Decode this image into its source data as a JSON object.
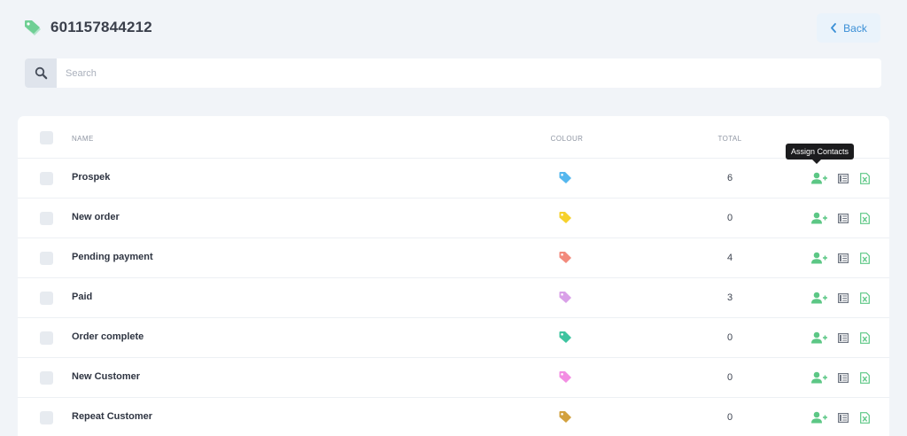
{
  "header": {
    "title": "601157844212",
    "icon": "tags-icon",
    "icon_color": "#7ed6a4",
    "back_label": "Back"
  },
  "search": {
    "placeholder": "Search",
    "value": ""
  },
  "table": {
    "columns": {
      "name": "NAME",
      "colour": "COLOUR",
      "total": "TOTAL"
    },
    "tooltip": "Assign Contacts",
    "rows": [
      {
        "name": "Prospek",
        "color": "#55b7ee",
        "total": "6"
      },
      {
        "name": "New order",
        "color": "#f6d12c",
        "total": "0"
      },
      {
        "name": "Pending payment",
        "color": "#f28a7c",
        "total": "4"
      },
      {
        "name": "Paid",
        "color": "#d9a0e8",
        "total": "3"
      },
      {
        "name": "Order complete",
        "color": "#3ec4a0",
        "total": "0"
      },
      {
        "name": "New Customer",
        "color": "#f38ee3",
        "total": "0"
      },
      {
        "name": "Repeat Customer",
        "color": "#d2a13f",
        "total": "0"
      }
    ]
  },
  "colors": {
    "accent_green": "#5cc785",
    "accent_blue": "#3a8fd6",
    "list_gray": "#6f7682"
  }
}
